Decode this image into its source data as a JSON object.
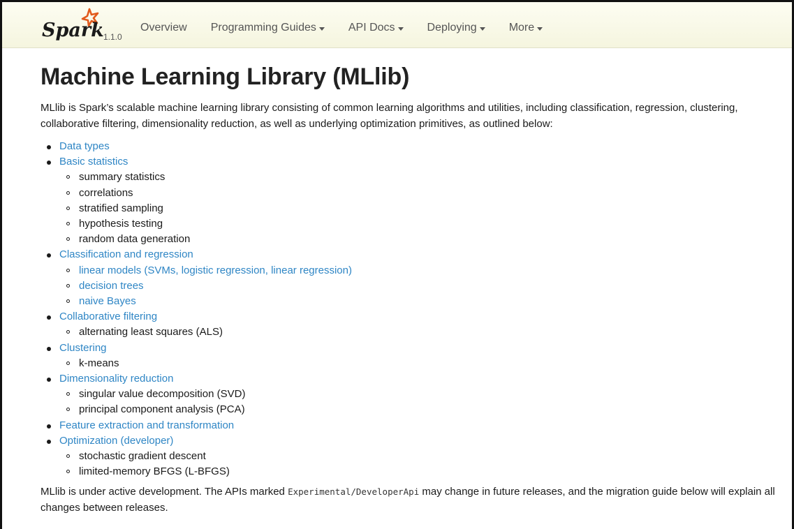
{
  "navbar": {
    "brand_name": "Spark",
    "version": "1.1.0",
    "items": [
      {
        "label": "Overview",
        "dropdown": false
      },
      {
        "label": "Programming Guides",
        "dropdown": true
      },
      {
        "label": "API Docs",
        "dropdown": true
      },
      {
        "label": "Deploying",
        "dropdown": true
      },
      {
        "label": "More",
        "dropdown": true
      }
    ]
  },
  "page": {
    "title": "Machine Learning Library (MLlib)",
    "intro": "MLlib is Spark’s scalable machine learning library consisting of common learning algorithms and utilities, including classification, regression, clustering, collaborative filtering, dimensionality reduction, as well as underlying optimization primitives, as outlined below:",
    "outline": [
      {
        "label": "Data types",
        "link": true,
        "children": []
      },
      {
        "label": "Basic statistics",
        "link": true,
        "children": [
          {
            "label": "summary statistics",
            "link": false
          },
          {
            "label": "correlations",
            "link": false
          },
          {
            "label": "stratified sampling",
            "link": false
          },
          {
            "label": "hypothesis testing",
            "link": false
          },
          {
            "label": "random data generation",
            "link": false
          }
        ]
      },
      {
        "label": "Classification and regression",
        "link": true,
        "children": [
          {
            "label": "linear models (SVMs, logistic regression, linear regression)",
            "link": true
          },
          {
            "label": "decision trees",
            "link": true
          },
          {
            "label": "naive Bayes",
            "link": true
          }
        ]
      },
      {
        "label": "Collaborative filtering",
        "link": true,
        "children": [
          {
            "label": "alternating least squares (ALS)",
            "link": false
          }
        ]
      },
      {
        "label": "Clustering",
        "link": true,
        "children": [
          {
            "label": "k-means",
            "link": false
          }
        ]
      },
      {
        "label": "Dimensionality reduction",
        "link": true,
        "children": [
          {
            "label": "singular value decomposition (SVD)",
            "link": false
          },
          {
            "label": "principal component analysis (PCA)",
            "link": false
          }
        ]
      },
      {
        "label": "Feature extraction and transformation",
        "link": true,
        "children": []
      },
      {
        "label": "Optimization (developer)",
        "link": true,
        "children": [
          {
            "label": "stochastic gradient descent",
            "link": false
          },
          {
            "label": "limited-memory BFGS (L-BFGS)",
            "link": false
          }
        ]
      }
    ],
    "outro_before": "MLlib is under active development. The APIs marked ",
    "outro_code": "Experimental/DeveloperApi",
    "outro_after": " may change in future releases, and the migration guide below will explain all changes between releases."
  },
  "colors": {
    "link": "#2f86c5",
    "navbar_bg": "#fdfdf2",
    "text": "#1a1a1a",
    "logo_star": "#e25a1c"
  }
}
